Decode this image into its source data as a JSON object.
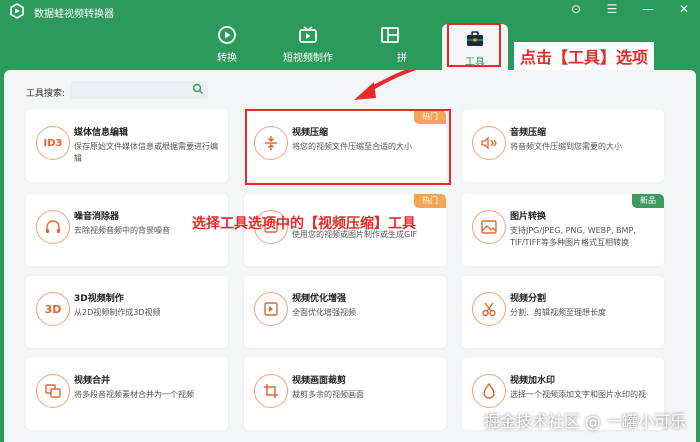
{
  "app": {
    "title": "数据蛙视频转换器"
  },
  "window_controls": [
    "⊙",
    "☰",
    "—",
    "✕"
  ],
  "nav_tabs": [
    {
      "label": "转换",
      "icon": "convert-icon"
    },
    {
      "label": "短视频制作",
      "icon": "short-video-icon"
    },
    {
      "label": "拼",
      "icon": "collage-icon"
    },
    {
      "label": "工具",
      "icon": "toolbox-icon",
      "active": true
    }
  ],
  "search": {
    "label": "工具搜索:",
    "placeholder": ""
  },
  "annotations": {
    "top_callout": "点击【工具】选项",
    "mid_callout": "选择工具选项中的【视频压缩】工具",
    "watermark": "掘金技术社区 @ 一罐小可乐"
  },
  "tools": [
    {
      "name": "媒体信息编辑",
      "desc": "保存原始文件媒体信息或根据需要进行编辑",
      "icon": "id3-icon",
      "glyph": "ID3"
    },
    {
      "name": "视频压缩",
      "desc": "将您的视频文件压缩至合适的大小",
      "icon": "compress-icon",
      "badge": "热门"
    },
    {
      "name": "音频压缩",
      "desc": "将音频文件压缩到您需要的大小",
      "icon": "audio-compress-icon"
    },
    {
      "name": "噪音消除器",
      "desc": "去除视频音频中的背景噪音",
      "icon": "noise-remover-icon"
    },
    {
      "name": "",
      "desc": "使用您的视频或图片制作或生成GIF",
      "icon": "gif-icon",
      "badge": "热门"
    },
    {
      "name": "图片转换",
      "desc": "支持JPG/JPEG, PNG, WEBP, BMP, TIF/TIFF等多种图片格式互相转换",
      "icon": "image-convert-icon",
      "badge": "新品"
    },
    {
      "name": "3D视频制作",
      "desc": "从2D视频制作成3D视频",
      "icon": "3d-icon",
      "glyph": "3D"
    },
    {
      "name": "视频优化增强",
      "desc": "全面优化增强视频",
      "icon": "enhance-icon"
    },
    {
      "name": "视频分割",
      "desc": "分割、剪辑视频至理想长度",
      "icon": "scissors-icon"
    },
    {
      "name": "视频合并",
      "desc": "将多段音视频素材合并为一个视频",
      "icon": "merge-icon"
    },
    {
      "name": "视频画面裁剪",
      "desc": "裁剪多余的视频画面",
      "icon": "crop-icon"
    },
    {
      "name": "视频加水印",
      "desc": "选择一个视频添加文字和图片水印的视",
      "icon": "watermark-icon"
    }
  ],
  "colors": {
    "brand": "#2c9a5b",
    "accent": "#e8652a",
    "highlight": "#e82a2a",
    "hot": "#f4a45a",
    "new": "#3f9a5e"
  }
}
